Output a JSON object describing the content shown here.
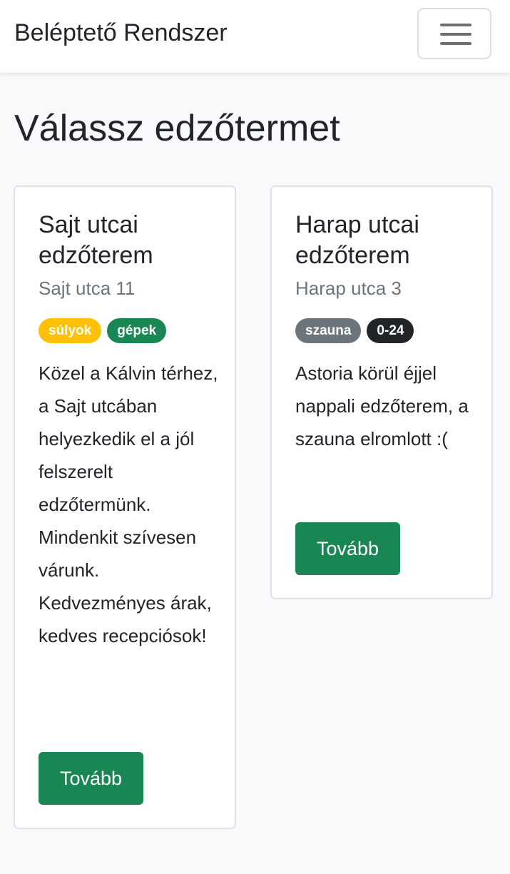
{
  "navbar": {
    "brand": "Beléptető Rendszer",
    "toggler_icon": "hamburger-menu-icon"
  },
  "page": {
    "title": "Válassz edzőtermet"
  },
  "colors": {
    "background": "#f8f9fa",
    "success": "#198754",
    "warning": "#ffc107",
    "secondary": "#6c757d",
    "dark": "#212529",
    "muted_text": "#6c757d"
  },
  "gyms": [
    {
      "title": "Sajt utcai edzőterem",
      "address": "Sajt utca 11",
      "tags": [
        {
          "label": "súlyok",
          "color": "#ffc107",
          "text_color": "#ffffff"
        },
        {
          "label": "gépek",
          "color": "#198754",
          "text_color": "#ffffff"
        }
      ],
      "description": "Közel a Kálvin térhez, a Sajt utcában helyezkedik el a jól felszerelt edzőtermünk. Mindenkit szívesen várunk. Kedvezményes árak, kedves recepciósok!",
      "button_label": "Tovább"
    },
    {
      "title": "Harap utcai edzőterem",
      "address": "Harap utca 3",
      "tags": [
        {
          "label": "szauna",
          "color": "#6c757d",
          "text_color": "#ffffff"
        },
        {
          "label": "0-24",
          "color": "#212529",
          "text_color": "#ffffff"
        }
      ],
      "description": "Astoria körül éjjel nappali edzőterem, a szauna elromlott :(",
      "button_label": "Tovább"
    }
  ]
}
